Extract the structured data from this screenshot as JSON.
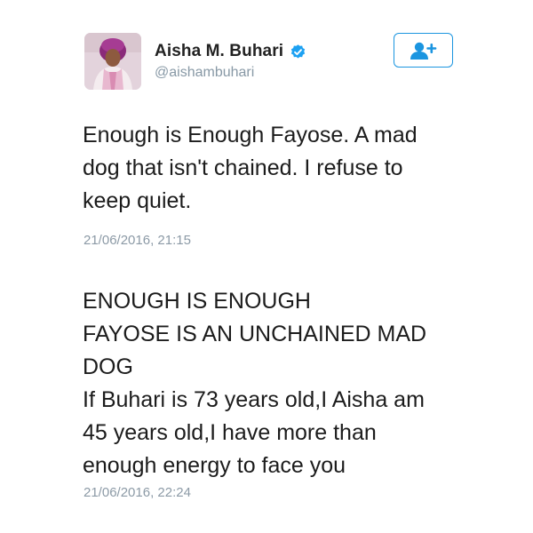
{
  "profile": {
    "display_name": "Aisha M. Buhari",
    "handle": "@aishambuhari",
    "verified": true,
    "avatar_icon": "profile-photo",
    "verified_icon": "verified-badge-icon",
    "accent_color": "#1b95e0"
  },
  "follow_button": {
    "icon": "add-user-icon"
  },
  "tweets": [
    {
      "text": "Enough is Enough Fayose. A mad\ndog that isn't chained.  I refuse to\nkeep quiet.",
      "timestamp": "21/06/2016, 21:15"
    },
    {
      "text": "ENOUGH IS ENOUGH\nFAYOSE IS AN UNCHAINED MAD\nDOG\nIf Buhari is 73 years old,I Aisha am\n45 years old,I have more than\nenough energy to face you",
      "timestamp": "21/06/2016, 22:24"
    }
  ]
}
